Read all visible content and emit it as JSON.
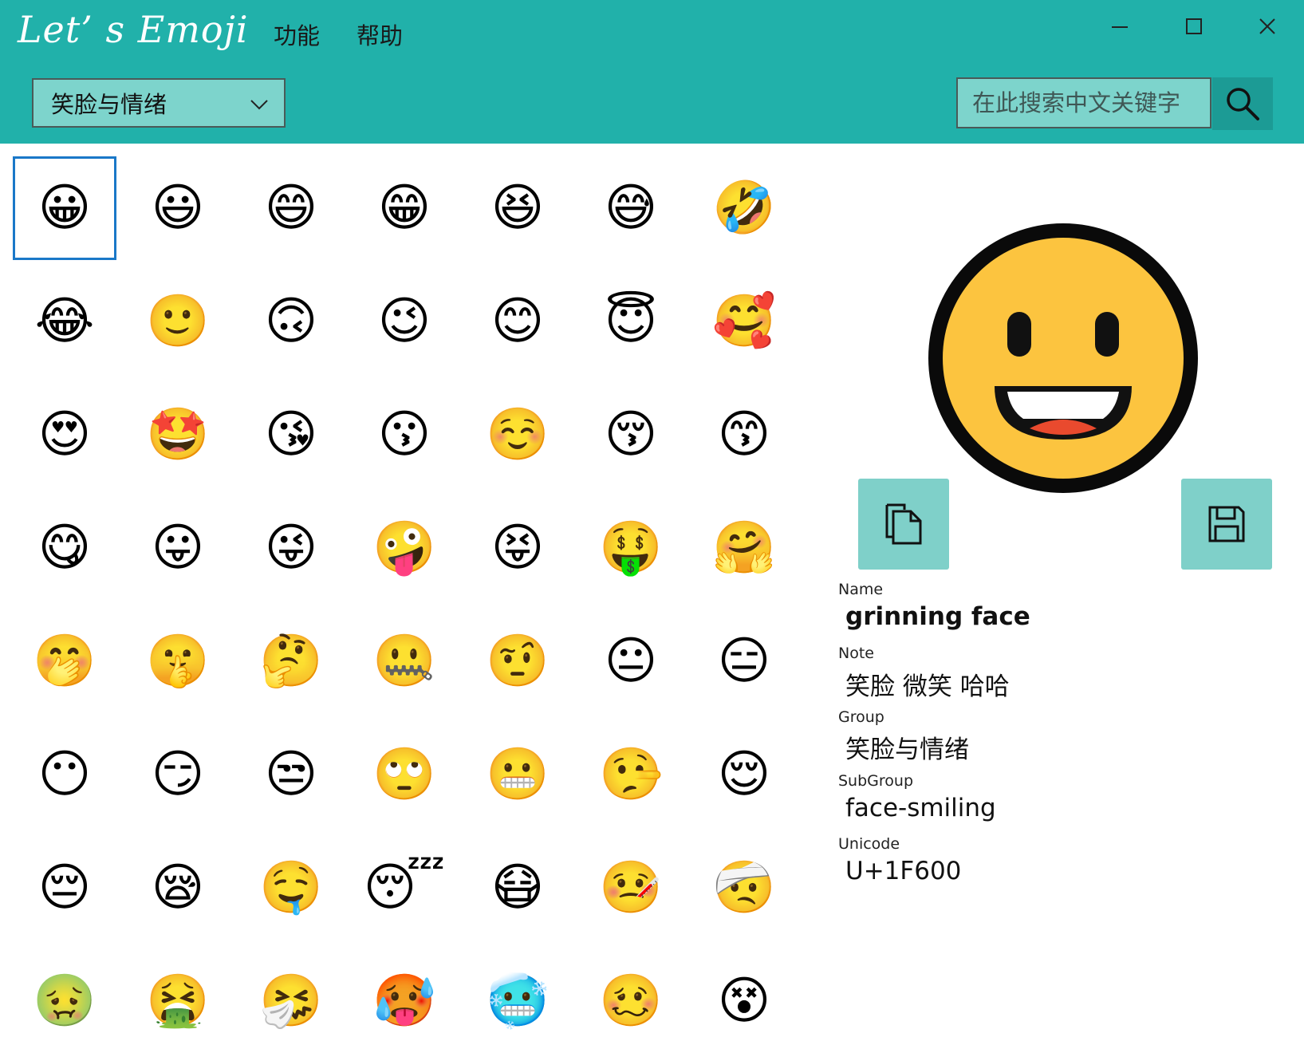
{
  "app": {
    "title": "Let’ s Emoji"
  },
  "menu": [
    {
      "label": "功能"
    },
    {
      "label": "帮助"
    }
  ],
  "toolbar": {
    "group_selected": "笑脸与情绪",
    "search_placeholder": "在此搜索中文关键字"
  },
  "colors": {
    "header": "#21b1aa",
    "control_bg": "#7dd4cc",
    "selection": "#1a78c8",
    "action_button": "#7fd0c9"
  },
  "emoji_grid": [
    "😀",
    "😃",
    "😄",
    "😁",
    "😆",
    "😅",
    "🤣",
    "😂",
    "🙂",
    "🙃",
    "😉",
    "😊",
    "😇",
    "🥰",
    "😍",
    "🤩",
    "😘",
    "😗",
    "☺️",
    "😚",
    "😙",
    "😋",
    "😛",
    "😜",
    "🤪",
    "😝",
    "🤑",
    "🤗",
    "🤭",
    "🤫",
    "🤔",
    "🤐",
    "🤨",
    "😐",
    "😑",
    "😶",
    "😏",
    "😒",
    "🙄",
    "😬",
    "🤥",
    "😌",
    "😔",
    "😪",
    "🤤",
    "😴",
    "😷",
    "🤒",
    "🤕",
    "🤢",
    "🤮",
    "🤧",
    "🥵",
    "🥶",
    "🥴",
    "😵"
  ],
  "selected_index": 0,
  "detail": {
    "name_label": "Name",
    "name": "grinning face",
    "note_label": "Note",
    "note": "笑脸 微笑 哈哈",
    "group_label": "Group",
    "group": "笑脸与情绪",
    "subgroup_label": "SubGroup",
    "subgroup": "face-smiling",
    "unicode_label": "Unicode",
    "unicode": "U+1F600"
  },
  "icons": {
    "minimize": "minimize-icon",
    "maximize": "maximize-icon",
    "close": "close-icon",
    "dropdown": "chevron-down-icon",
    "search": "search-icon",
    "copy": "copy-icon",
    "save": "save-icon"
  }
}
